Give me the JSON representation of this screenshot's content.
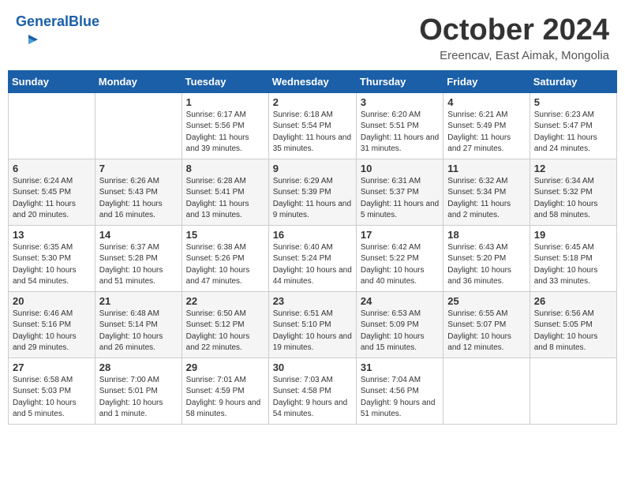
{
  "header": {
    "logo_general": "General",
    "logo_blue": "Blue",
    "month_title": "October 2024",
    "location": "Ereencav, East Aimak, Mongolia"
  },
  "days_of_week": [
    "Sunday",
    "Monday",
    "Tuesday",
    "Wednesday",
    "Thursday",
    "Friday",
    "Saturday"
  ],
  "weeks": [
    [
      {
        "day": "",
        "sunrise": "",
        "sunset": "",
        "daylight": ""
      },
      {
        "day": "",
        "sunrise": "",
        "sunset": "",
        "daylight": ""
      },
      {
        "day": "1",
        "sunrise": "Sunrise: 6:17 AM",
        "sunset": "Sunset: 5:56 PM",
        "daylight": "Daylight: 11 hours and 39 minutes."
      },
      {
        "day": "2",
        "sunrise": "Sunrise: 6:18 AM",
        "sunset": "Sunset: 5:54 PM",
        "daylight": "Daylight: 11 hours and 35 minutes."
      },
      {
        "day": "3",
        "sunrise": "Sunrise: 6:20 AM",
        "sunset": "Sunset: 5:51 PM",
        "daylight": "Daylight: 11 hours and 31 minutes."
      },
      {
        "day": "4",
        "sunrise": "Sunrise: 6:21 AM",
        "sunset": "Sunset: 5:49 PM",
        "daylight": "Daylight: 11 hours and 27 minutes."
      },
      {
        "day": "5",
        "sunrise": "Sunrise: 6:23 AM",
        "sunset": "Sunset: 5:47 PM",
        "daylight": "Daylight: 11 hours and 24 minutes."
      }
    ],
    [
      {
        "day": "6",
        "sunrise": "Sunrise: 6:24 AM",
        "sunset": "Sunset: 5:45 PM",
        "daylight": "Daylight: 11 hours and 20 minutes."
      },
      {
        "day": "7",
        "sunrise": "Sunrise: 6:26 AM",
        "sunset": "Sunset: 5:43 PM",
        "daylight": "Daylight: 11 hours and 16 minutes."
      },
      {
        "day": "8",
        "sunrise": "Sunrise: 6:28 AM",
        "sunset": "Sunset: 5:41 PM",
        "daylight": "Daylight: 11 hours and 13 minutes."
      },
      {
        "day": "9",
        "sunrise": "Sunrise: 6:29 AM",
        "sunset": "Sunset: 5:39 PM",
        "daylight": "Daylight: 11 hours and 9 minutes."
      },
      {
        "day": "10",
        "sunrise": "Sunrise: 6:31 AM",
        "sunset": "Sunset: 5:37 PM",
        "daylight": "Daylight: 11 hours and 5 minutes."
      },
      {
        "day": "11",
        "sunrise": "Sunrise: 6:32 AM",
        "sunset": "Sunset: 5:34 PM",
        "daylight": "Daylight: 11 hours and 2 minutes."
      },
      {
        "day": "12",
        "sunrise": "Sunrise: 6:34 AM",
        "sunset": "Sunset: 5:32 PM",
        "daylight": "Daylight: 10 hours and 58 minutes."
      }
    ],
    [
      {
        "day": "13",
        "sunrise": "Sunrise: 6:35 AM",
        "sunset": "Sunset: 5:30 PM",
        "daylight": "Daylight: 10 hours and 54 minutes."
      },
      {
        "day": "14",
        "sunrise": "Sunrise: 6:37 AM",
        "sunset": "Sunset: 5:28 PM",
        "daylight": "Daylight: 10 hours and 51 minutes."
      },
      {
        "day": "15",
        "sunrise": "Sunrise: 6:38 AM",
        "sunset": "Sunset: 5:26 PM",
        "daylight": "Daylight: 10 hours and 47 minutes."
      },
      {
        "day": "16",
        "sunrise": "Sunrise: 6:40 AM",
        "sunset": "Sunset: 5:24 PM",
        "daylight": "Daylight: 10 hours and 44 minutes."
      },
      {
        "day": "17",
        "sunrise": "Sunrise: 6:42 AM",
        "sunset": "Sunset: 5:22 PM",
        "daylight": "Daylight: 10 hours and 40 minutes."
      },
      {
        "day": "18",
        "sunrise": "Sunrise: 6:43 AM",
        "sunset": "Sunset: 5:20 PM",
        "daylight": "Daylight: 10 hours and 36 minutes."
      },
      {
        "day": "19",
        "sunrise": "Sunrise: 6:45 AM",
        "sunset": "Sunset: 5:18 PM",
        "daylight": "Daylight: 10 hours and 33 minutes."
      }
    ],
    [
      {
        "day": "20",
        "sunrise": "Sunrise: 6:46 AM",
        "sunset": "Sunset: 5:16 PM",
        "daylight": "Daylight: 10 hours and 29 minutes."
      },
      {
        "day": "21",
        "sunrise": "Sunrise: 6:48 AM",
        "sunset": "Sunset: 5:14 PM",
        "daylight": "Daylight: 10 hours and 26 minutes."
      },
      {
        "day": "22",
        "sunrise": "Sunrise: 6:50 AM",
        "sunset": "Sunset: 5:12 PM",
        "daylight": "Daylight: 10 hours and 22 minutes."
      },
      {
        "day": "23",
        "sunrise": "Sunrise: 6:51 AM",
        "sunset": "Sunset: 5:10 PM",
        "daylight": "Daylight: 10 hours and 19 minutes."
      },
      {
        "day": "24",
        "sunrise": "Sunrise: 6:53 AM",
        "sunset": "Sunset: 5:09 PM",
        "daylight": "Daylight: 10 hours and 15 minutes."
      },
      {
        "day": "25",
        "sunrise": "Sunrise: 6:55 AM",
        "sunset": "Sunset: 5:07 PM",
        "daylight": "Daylight: 10 hours and 12 minutes."
      },
      {
        "day": "26",
        "sunrise": "Sunrise: 6:56 AM",
        "sunset": "Sunset: 5:05 PM",
        "daylight": "Daylight: 10 hours and 8 minutes."
      }
    ],
    [
      {
        "day": "27",
        "sunrise": "Sunrise: 6:58 AM",
        "sunset": "Sunset: 5:03 PM",
        "daylight": "Daylight: 10 hours and 5 minutes."
      },
      {
        "day": "28",
        "sunrise": "Sunrise: 7:00 AM",
        "sunset": "Sunset: 5:01 PM",
        "daylight": "Daylight: 10 hours and 1 minute."
      },
      {
        "day": "29",
        "sunrise": "Sunrise: 7:01 AM",
        "sunset": "Sunset: 4:59 PM",
        "daylight": "Daylight: 9 hours and 58 minutes."
      },
      {
        "day": "30",
        "sunrise": "Sunrise: 7:03 AM",
        "sunset": "Sunset: 4:58 PM",
        "daylight": "Daylight: 9 hours and 54 minutes."
      },
      {
        "day": "31",
        "sunrise": "Sunrise: 7:04 AM",
        "sunset": "Sunset: 4:56 PM",
        "daylight": "Daylight: 9 hours and 51 minutes."
      },
      {
        "day": "",
        "sunrise": "",
        "sunset": "",
        "daylight": ""
      },
      {
        "day": "",
        "sunrise": "",
        "sunset": "",
        "daylight": ""
      }
    ]
  ]
}
